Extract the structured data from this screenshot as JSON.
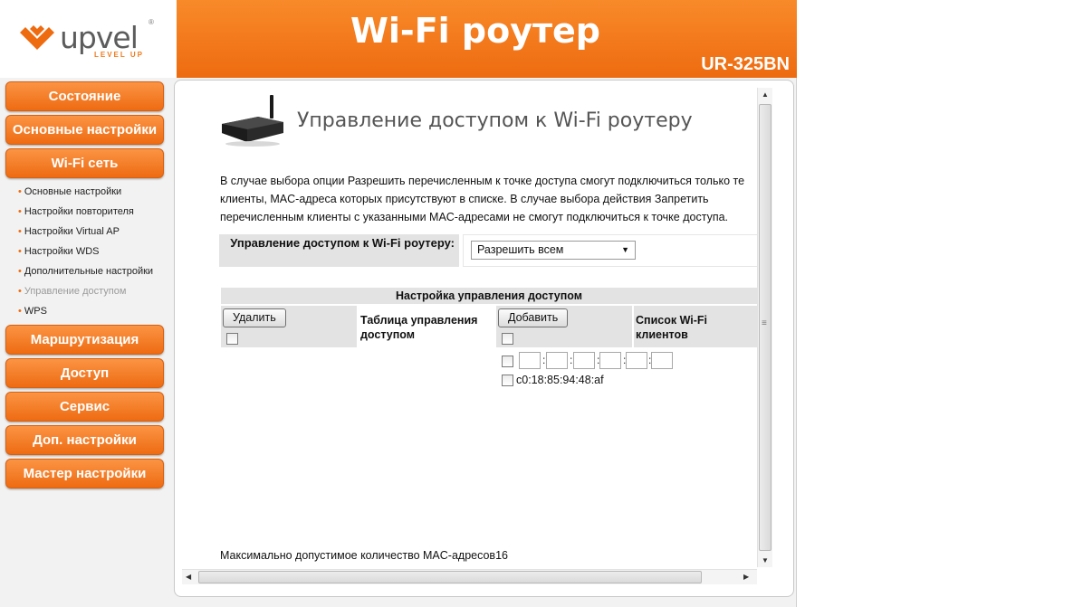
{
  "brand": {
    "logo_text": "upvel",
    "tagline": "LEVEL UP",
    "registered": "®",
    "accent_color": "#ee6b10"
  },
  "header": {
    "title": "Wi-Fi роутер",
    "model": "UR-325BN"
  },
  "sidebar": {
    "items": [
      {
        "label": "Состояние"
      },
      {
        "label": "Основные настройки"
      },
      {
        "label": "Wi-Fi сеть"
      },
      {
        "label": "Маршрутизация"
      },
      {
        "label": "Доступ"
      },
      {
        "label": "Сервис"
      },
      {
        "label": "Доп. настройки"
      },
      {
        "label": "Мастер настройки"
      }
    ],
    "wifi_subitems": [
      {
        "label": "Основные настройки"
      },
      {
        "label": "Настройки повторителя"
      },
      {
        "label": "Настройки Virtual AP"
      },
      {
        "label": "Настройки WDS"
      },
      {
        "label": "Дополнительные настройки"
      },
      {
        "label": "Управление доступом",
        "active": true
      },
      {
        "label": "WPS"
      }
    ],
    "bullet": "•"
  },
  "main": {
    "title": "Управление доступом к Wi-Fi роутеру",
    "description": "В случае выбора опции Разрешить перечисленным к точке доступа смогут подключиться только те клиенты, MAC-адреса которых присутствуют в списке. В случае выбора действия Запретить перечисленным клиенты с указанными MAC-адресами не смогут подключиться к точке доступа.",
    "access_control": {
      "label": "Управление доступом к Wi-Fi роутеру:",
      "selected": "Разрешить всем"
    },
    "section_title": "Настройка управления доступом",
    "delete_button": "Удалить",
    "table_label": "Таблица управления доступом",
    "add_button": "Добавить",
    "clients_label": "Список Wi-Fi клиентов",
    "mac_separator": ":",
    "clients": [
      {
        "mac": "c0:18:85:94:48:af"
      }
    ],
    "footer_note": "Максимально допустимое количество MAC-адресов16"
  }
}
